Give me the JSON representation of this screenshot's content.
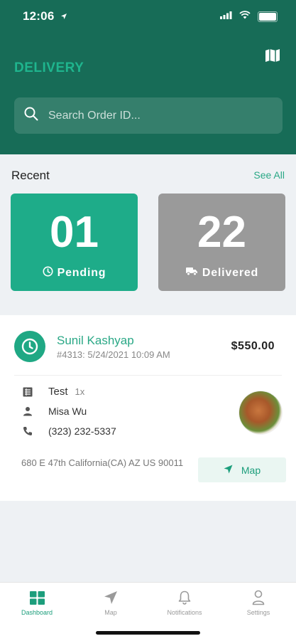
{
  "status_bar": {
    "time": "12:06"
  },
  "header": {
    "brand": "DELIVERY",
    "search_placeholder": "Search Order ID...",
    "colors": {
      "header_bg": "#176c57",
      "brand": "#1fb58e"
    }
  },
  "recent": {
    "title": "Recent",
    "see_all": "See All",
    "pending": {
      "count": "01",
      "label": "Pending",
      "color": "#1eac89"
    },
    "delivered": {
      "count": "22",
      "label": "Delivered",
      "color": "#9a9a9a"
    }
  },
  "order": {
    "customer": "Sunil Kashyap",
    "meta": "#4313: 5/24/2021 10:09 AM",
    "price": "$550.00",
    "item_name": "Test",
    "item_qty": "1x",
    "contact_name": "Misa Wu",
    "phone": "(323) 232-5337",
    "address": "680 E 47th California(CA) AZ US 90011",
    "map_label": "Map"
  },
  "tabs": [
    {
      "label": "Dashboard",
      "icon": "dashboard-icon",
      "active": true
    },
    {
      "label": "Map",
      "icon": "navigation-icon",
      "active": false
    },
    {
      "label": "Notifications",
      "icon": "bell-icon",
      "active": false
    },
    {
      "label": "Settings",
      "icon": "user-icon",
      "active": false
    }
  ]
}
